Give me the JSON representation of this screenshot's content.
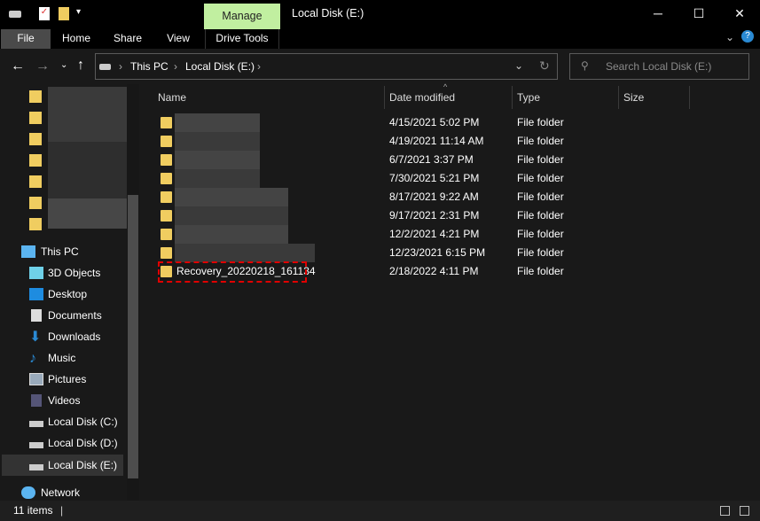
{
  "titlebar": {
    "title": "Local Disk (E:)",
    "context_tab": "Manage",
    "minimize": "─",
    "maximize": "☐",
    "close": "✕"
  },
  "ribbon": {
    "tabs": [
      "File",
      "Home",
      "Share",
      "View",
      "Drive Tools"
    ],
    "expand": "⌄",
    "help": "?"
  },
  "address": {
    "crumbs": [
      "This PC",
      "Local Disk (E:)"
    ],
    "search_placeholder": "Search Local Disk (E:)"
  },
  "nav": {
    "items": [
      "This PC",
      "3D Objects",
      "Desktop",
      "Documents",
      "Downloads",
      "Music",
      "Pictures",
      "Videos",
      "Local Disk (C:)",
      "Local Disk (D:)",
      "Local Disk (E:)",
      "Network"
    ]
  },
  "columns": [
    "Name",
    "Date modified",
    "Type",
    "Size"
  ],
  "files": [
    {
      "name": "",
      "date": "4/15/2021 5:02 PM",
      "type": "File folder"
    },
    {
      "name": "",
      "date": "4/19/2021 11:14 AM",
      "type": "File folder"
    },
    {
      "name": "",
      "date": "6/7/2021 3:37 PM",
      "type": "File folder"
    },
    {
      "name": "",
      "date": "7/30/2021 5:21 PM",
      "type": "File folder"
    },
    {
      "name": "",
      "date": "8/17/2021 9:22 AM",
      "type": "File folder"
    },
    {
      "name": "",
      "date": "9/17/2021 2:31 PM",
      "type": "File folder"
    },
    {
      "name": "",
      "date": "12/2/2021 4:21 PM",
      "type": "File folder"
    },
    {
      "name": "",
      "date": "12/23/2021 6:15 PM",
      "type": "File folder"
    },
    {
      "name": "Recovery_20220218_161134",
      "date": "2/18/2022 4:11 PM",
      "type": "File folder"
    }
  ],
  "status": {
    "count": "11 items"
  },
  "colors": {
    "manage": "#c1efa0",
    "highlight": "#e00000"
  }
}
